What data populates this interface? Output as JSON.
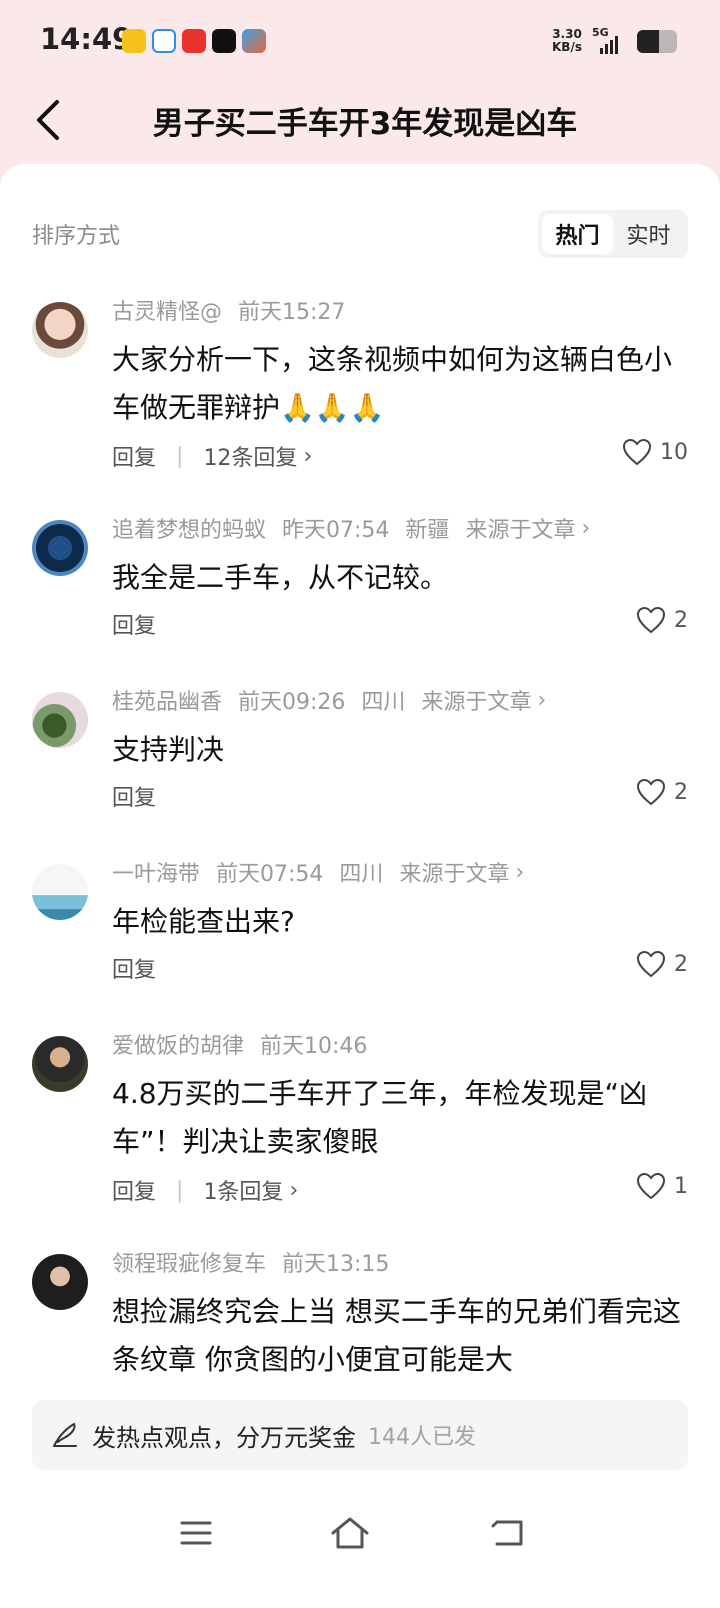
{
  "status_bar": {
    "time": "14:49",
    "net_speed_value": "3.30",
    "net_speed_unit": "KB/s",
    "signal_label": "5G",
    "battery_level": 0.55
  },
  "header": {
    "back_icon": "chevron-left-icon",
    "title": "男子买二手车开3年发现是凶车"
  },
  "sort": {
    "label": "排序方式",
    "options": [
      "热门",
      "实时"
    ],
    "selected": "热门"
  },
  "comments": [
    {
      "user": "古灵精怪@",
      "time": "前天15:27",
      "location": "",
      "source": "",
      "text": "大家分析一下，这条视频中如何为这辆白色小车做无罪辩护🙏🙏🙏",
      "reply_label": "回复",
      "replies": "12条回复",
      "likes": "10"
    },
    {
      "user": "追着梦想的蚂蚁",
      "time": "昨天07:54",
      "location": "新疆",
      "source": "来源于文章",
      "text": "我全是二手车，从不记较。",
      "reply_label": "回复",
      "replies": "",
      "likes": "2"
    },
    {
      "user": "桂苑品幽香",
      "time": "前天09:26",
      "location": "四川",
      "source": "来源于文章",
      "text": "支持判决",
      "reply_label": "回复",
      "replies": "",
      "likes": "2"
    },
    {
      "user": "一叶海带",
      "time": "前天07:54",
      "location": "四川",
      "source": "来源于文章",
      "text": "年检能查出来?",
      "reply_label": "回复",
      "replies": "",
      "likes": "2"
    },
    {
      "user": "爱做饭的胡律",
      "time": "前天10:46",
      "location": "",
      "source": "",
      "text": "4.8万买的二手车开了三年，年检发现是“凶车”！判决让卖家傻眼",
      "reply_label": "回复",
      "replies": "1条回复",
      "likes": "1"
    },
    {
      "user": "领程瑕疵修复车",
      "time": "前天13:15",
      "location": "",
      "source": "",
      "text": "想捡漏终究会上当 想买二手车的兄弟们看完这条纹章 你贪图的小便宜可能是大",
      "reply_label": "",
      "replies": "",
      "likes": ""
    }
  ],
  "post_bar": {
    "icon": "pen-icon",
    "text": "发热点观点，分万元奖金",
    "count": "144人已发"
  },
  "navbar": {
    "menu_icon": "menu-icon",
    "home_icon": "home-icon",
    "back_icon": "back-icon"
  },
  "colors": {
    "header_bg": "#fbe9ea",
    "card_bg": "#ffffff",
    "text_primary": "#111111",
    "text_secondary": "#9a9a9a"
  }
}
